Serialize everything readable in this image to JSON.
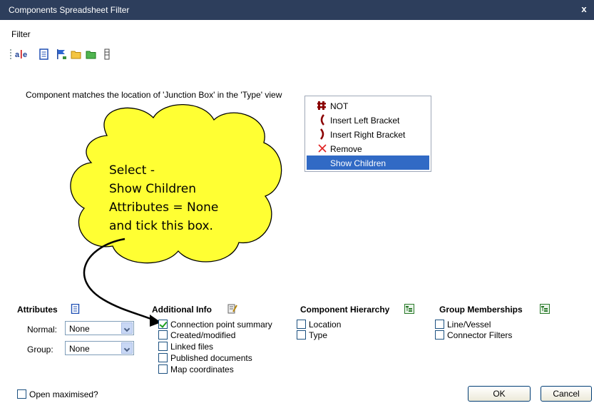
{
  "window": {
    "title": "Components Spreadsheet Filter",
    "close_glyph": "x"
  },
  "menubar": {
    "items": [
      "Filter"
    ]
  },
  "toolbar": {
    "icons": [
      "and-or-icon",
      "document-icon",
      "flag-icon",
      "folder-open-icon",
      "folder-green-icon",
      "column-icon"
    ]
  },
  "rule": {
    "text": "Component matches the location of 'Junction Box' in the 'Type' view"
  },
  "context_menu": {
    "items": [
      {
        "label": "NOT",
        "icon": "not-icon",
        "selected": false
      },
      {
        "label": "Insert Left Bracket",
        "icon": "left-bracket-icon",
        "selected": false
      },
      {
        "label": "Insert Right Bracket",
        "icon": "right-bracket-icon",
        "selected": false
      },
      {
        "label": "Remove",
        "icon": "remove-x-icon",
        "selected": false
      },
      {
        "label": "Show Children",
        "icon": "",
        "selected": true
      }
    ]
  },
  "callout": {
    "lines": [
      "Select -",
      "Show Children",
      "Attributes = None",
      "and tick this box."
    ],
    "fill": "#ffff33"
  },
  "attributes": {
    "heading": "Attributes",
    "normal_label": "Normal:",
    "normal_value": "None",
    "group_label": "Group:",
    "group_value": "None"
  },
  "additional_info": {
    "heading": "Additional Info",
    "items": [
      {
        "label": "Connection point summary",
        "checked": true
      },
      {
        "label": "Created/modified",
        "checked": false
      },
      {
        "label": "Linked files",
        "checked": false
      },
      {
        "label": "Published documents",
        "checked": false
      },
      {
        "label": "Map coordinates",
        "checked": false
      }
    ]
  },
  "component_hierarchy": {
    "heading": "Component Hierarchy",
    "items": [
      {
        "label": "Location",
        "checked": false
      },
      {
        "label": "Type",
        "checked": false
      }
    ]
  },
  "group_memberships": {
    "heading": "Group Memberships",
    "items": [
      {
        "label": "Line/Vessel",
        "checked": false
      },
      {
        "label": "Connector Filters",
        "checked": false
      }
    ]
  },
  "footer": {
    "open_maximised_label": "Open maximised?",
    "open_maximised_checked": false,
    "ok_label": "OK",
    "cancel_label": "Cancel"
  },
  "colors": {
    "titlebar": "#2d3e5c",
    "selection": "#316ac5",
    "callout": "#ffff33"
  }
}
